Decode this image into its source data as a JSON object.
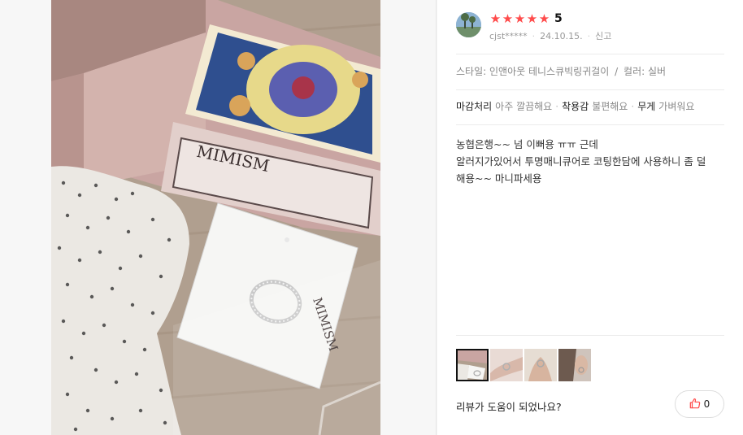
{
  "review": {
    "rating_stars": 5,
    "rating_value": "5",
    "username": "cjst*****",
    "date": "24.10.15.",
    "report_label": "신고",
    "options": {
      "style_label": "스타일:",
      "style_value": "인앤아웃 테니스큐빅링귀걸이",
      "color_label": "컬러:",
      "color_value": "실버"
    },
    "evaluations": [
      {
        "key": "마감처리",
        "value": "아주 깔끔해요"
      },
      {
        "key": "착용감",
        "value": "불편해요"
      },
      {
        "key": "무게",
        "value": "가벼워요"
      }
    ],
    "body_lines": [
      "농협은행~~ 넘 이뻐용 ㅠㅠ 근데",
      "알러지가있어서 투명매니큐어로 코팅한담에 사용하니 좀 덜",
      "해용~~ 마니파세용"
    ],
    "thumbnails": [
      {
        "name": "thumbnail-box-ring",
        "selected": true
      },
      {
        "name": "thumbnail-hand-ring-1",
        "selected": false
      },
      {
        "name": "thumbnail-hand-ring-2",
        "selected": false
      },
      {
        "name": "thumbnail-ear-ring",
        "selected": false
      }
    ],
    "helpful_question": "리뷰가 도움이 되었나요?",
    "like_count": "0"
  },
  "photo": {
    "box_brand": "MIMISM",
    "card_brand": "MIMISM"
  },
  "colors": {
    "star": "#ff4b4b",
    "like_icon": "#ff4b4b",
    "text_muted": "#888888"
  },
  "icons": {
    "star": "star-icon",
    "like": "thumbs-up-icon"
  }
}
